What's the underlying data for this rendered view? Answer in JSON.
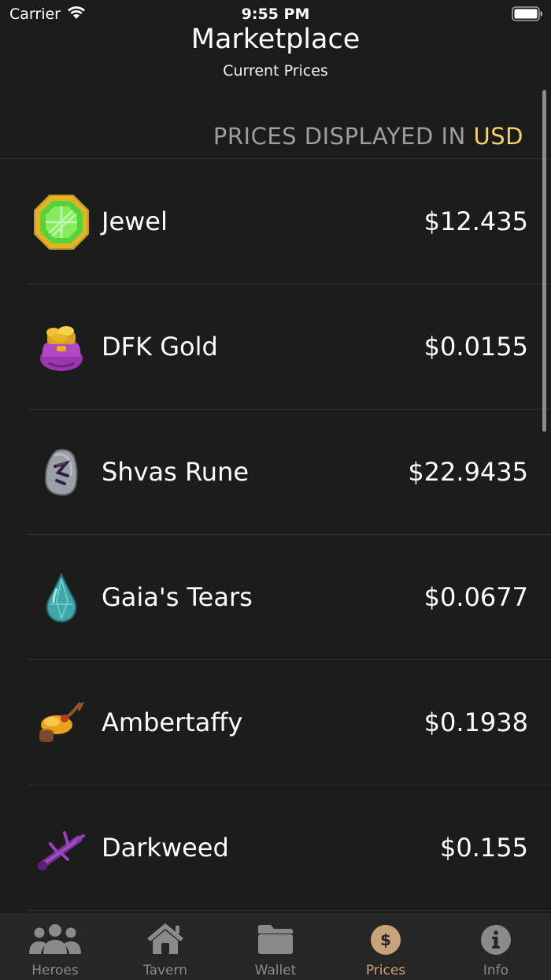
{
  "status_bar": {
    "carrier": "Carrier",
    "time": "9:55 PM"
  },
  "nav": {
    "title": "Marketplace",
    "subtitle": "Current Prices"
  },
  "section": {
    "prefix": "PRICES DISPLAYED IN ",
    "currency": "USD"
  },
  "items": [
    {
      "name": "Jewel",
      "price": "$12.435",
      "icon": "jewel-icon"
    },
    {
      "name": "DFK Gold",
      "price": "$0.0155",
      "icon": "gold-bag-icon"
    },
    {
      "name": "Shvas Rune",
      "price": "$22.9435",
      "icon": "rune-icon"
    },
    {
      "name": "Gaia's Tears",
      "price": "$0.0677",
      "icon": "tear-drop-icon"
    },
    {
      "name": "Ambertaffy",
      "price": "$0.1938",
      "icon": "ambertaffy-icon"
    },
    {
      "name": "Darkweed",
      "price": "$0.155",
      "icon": "darkweed-icon"
    }
  ],
  "tabs": [
    {
      "label": "Heroes",
      "icon": "heroes-icon"
    },
    {
      "label": "Tavern",
      "icon": "house-icon"
    },
    {
      "label": "Wallet",
      "icon": "folder-icon"
    },
    {
      "label": "Prices",
      "icon": "dollar-icon",
      "active": true
    },
    {
      "label": "Info",
      "icon": "info-icon"
    }
  ],
  "colors": {
    "accent_currency": "#f3d35d",
    "active_tab": "#c9a27a",
    "background": "#1c1c1c"
  }
}
